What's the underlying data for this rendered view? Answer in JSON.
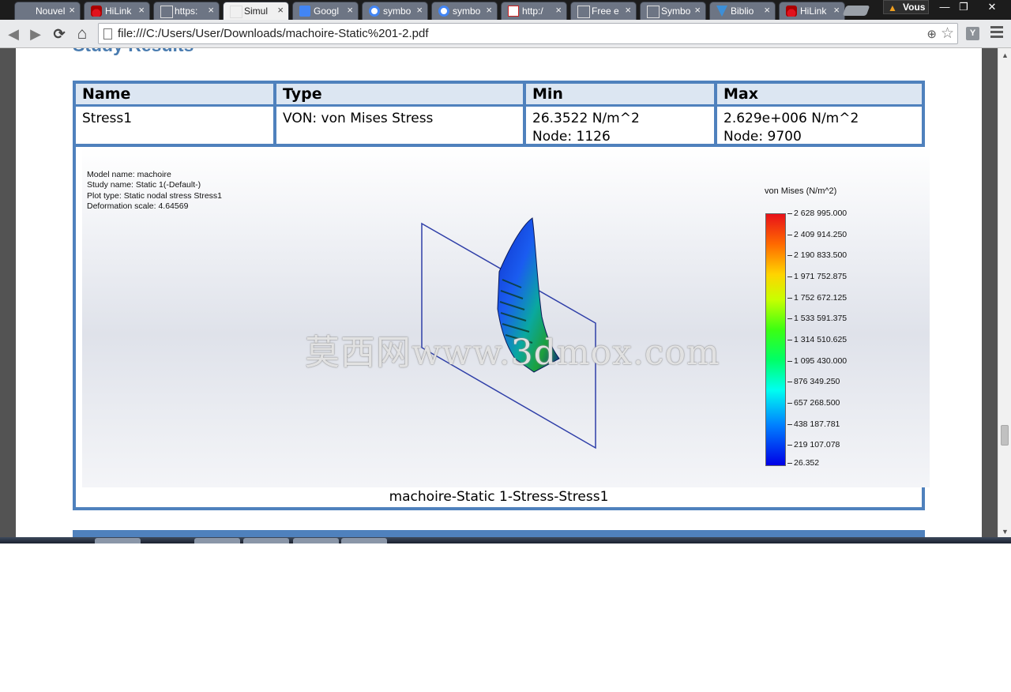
{
  "browser": {
    "tabs": [
      {
        "label": "Nouvel o",
        "icon": "blank-tab-icon"
      },
      {
        "label": "HiLink",
        "icon": "huawei-icon"
      },
      {
        "label": "https:",
        "icon": "page-icon"
      },
      {
        "label": "Simul",
        "icon": "page-icon",
        "active": true
      },
      {
        "label": "Googl",
        "icon": "google-translate-icon"
      },
      {
        "label": "symbo",
        "icon": "google-icon"
      },
      {
        "label": "symbo",
        "icon": "google-icon"
      },
      {
        "label": "http:/",
        "icon": "pdf-icon"
      },
      {
        "label": "Free e",
        "icon": "page-icon"
      },
      {
        "label": "Symbo",
        "icon": "page-icon"
      },
      {
        "label": "Biblio",
        "icon": "bookmark-v-icon"
      },
      {
        "label": "HiLink",
        "icon": "huawei-icon"
      }
    ],
    "tab_close_glyph": "×",
    "profile_label": "Vous",
    "window_controls": {
      "minimize": "—",
      "restore": "❐",
      "close": "✕"
    },
    "nav": {
      "back": "◀",
      "forward": "▶",
      "reload": "⟳",
      "home": "⌂"
    },
    "url": "file:///C:/Users/User/Downloads/machoire-Static%201-2.pdf",
    "extension_label": "Y"
  },
  "document": {
    "heading": "Study Results",
    "table": {
      "headers": [
        "Name",
        "Type",
        "Min",
        "Max"
      ],
      "row": {
        "name": "Stress1",
        "type": "VON: von Mises Stress",
        "min_value": "26.3522 N/m^2",
        "min_node": "Node: 1126",
        "max_value": "2.629e+006 N/m^2",
        "max_node": "Node: 9700"
      }
    },
    "plot": {
      "model_info": [
        "Model name: machoire",
        "Study name: Static 1(-Default-)",
        "Plot type: Static nodal stress Stress1",
        "Deformation scale: 4.64569"
      ],
      "legend_title": "von Mises (N/m^2)",
      "legend_values": [
        "2 628 995.000",
        "2 409 914.250",
        "2 190 833.500",
        "1 971 752.875",
        "1 752 672.125",
        "1 533 591.375",
        "1 314 510.625",
        "1 095 430.000",
        "876 349.250",
        "657 268.500",
        "438 187.781",
        "219 107.078",
        "26.352"
      ],
      "watermark": "莫西网www.3dmox.com",
      "caption": "machoire-Static 1-Stress-Stress1"
    }
  },
  "colors": {
    "table_border": "#4f81bd",
    "header_fill": "#dce6f2",
    "heading_color": "#4a7cb0"
  }
}
